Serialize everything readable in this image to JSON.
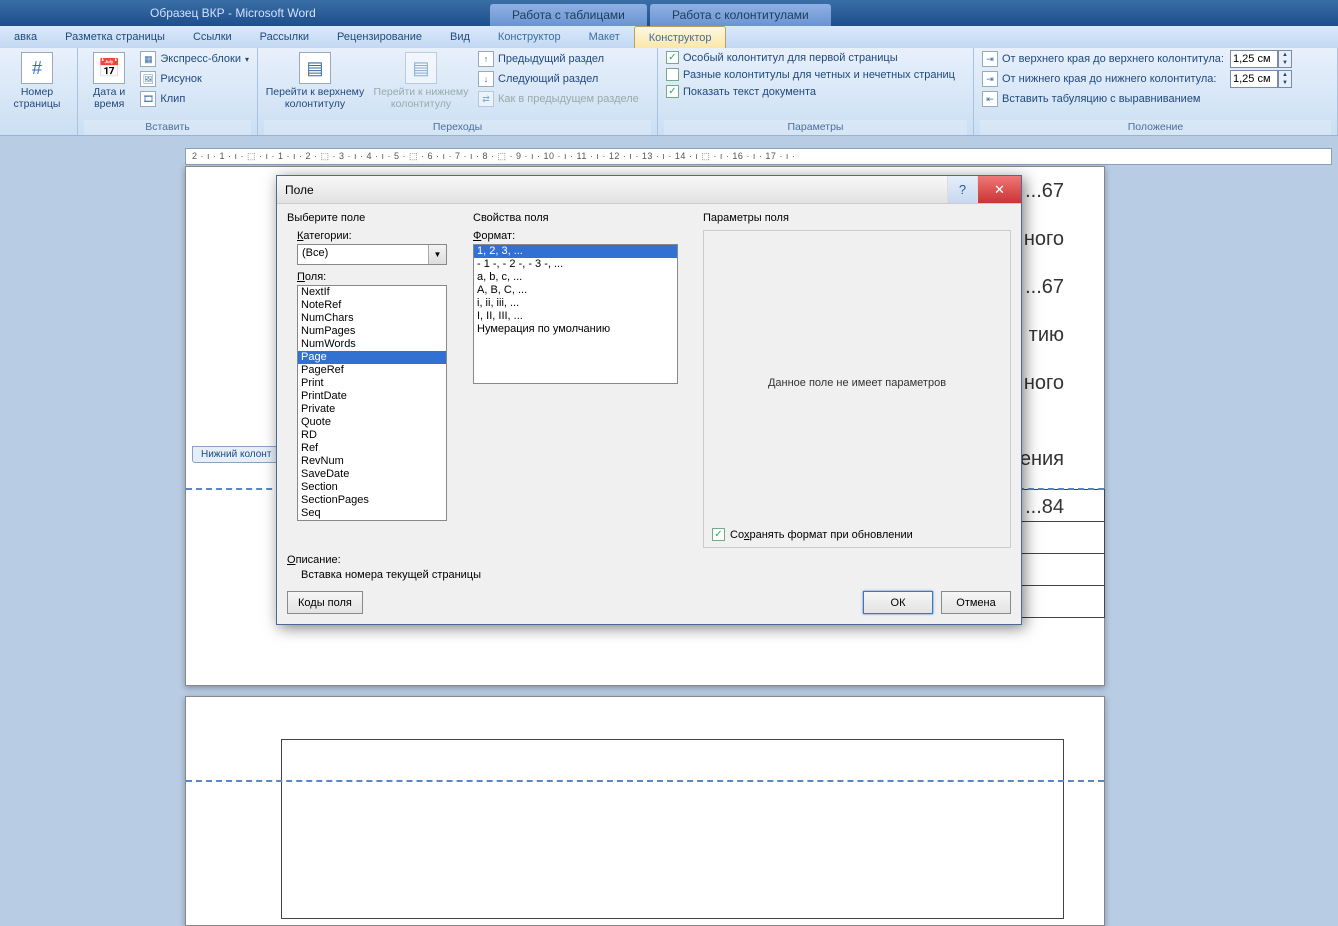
{
  "titlebar": {
    "doc": "Образец ВКР - Microsoft Word",
    "ctx1": "Работа с таблицами",
    "ctx2": "Работа с колонтитулами"
  },
  "tabs": {
    "t0": "авка",
    "t1": "Разметка страницы",
    "t2": "Ссылки",
    "t3": "Рассылки",
    "t4": "Рецензирование",
    "t5": "Вид",
    "t6": "Конструктор",
    "t7": "Макет",
    "t8": "Конструктор"
  },
  "ribbon": {
    "page_number": "Номер страницы",
    "date_time": "Дата и время",
    "express": "Экспресс-блоки",
    "picture": "Рисунок",
    "clip": "Клип",
    "insert_grp": "Вставить",
    "goto_top": "Перейти к верхнему колонтитулу",
    "goto_bottom": "Перейти к нижнему колонтитулу",
    "prev_section": "Предыдущий раздел",
    "next_section": "Следующий раздел",
    "as_prev": "Как в предыдущем разделе",
    "nav_grp": "Переходы",
    "special_first": "Особый колонтитул для первой страницы",
    "odd_even": "Разные колонтитулы для четных и нечетных страниц",
    "show_doc": "Показать текст документа",
    "params_grp": "Параметры",
    "from_top": "От верхнего края до верхнего колонтитула:",
    "from_bottom": "От нижнего края до нижнего колонтитула:",
    "insert_tab": "Вставить табуляцию с выравниванием",
    "pos_grp": "Положение",
    "val_top": "1,25 см",
    "val_bottom": "1,25 см"
  },
  "ruler_text": "2 · ı · 1 · ı · ⬚ · ı · 1 · ı · 2 · ⬚ · 3 · ı · 4 · ı · 5 · ⬚ · 6 · ı · 7 · ı · 8 · ⬚ · 9 · ı · 10 · ı · 11 · ı · 12 · ı · 13 · ı · 14 · ı ⬚ · ı · 16 · ı · 17 · ı · ",
  "footer_tab": "Нижний колонт",
  "doc_text": {
    "l1": "...67",
    "l2": "ного",
    "l3": "...67",
    "l4": "тию",
    "l5": "ного",
    "l6": "ения",
    "l7": "...84"
  },
  "dialog": {
    "title": "Поле",
    "col1_head": "Выберите поле",
    "categories_lbl": "Категории:",
    "categories_accel": "К",
    "category_val": "(Все)",
    "fields_lbl": "Поля:",
    "fields_accel": "П",
    "fields": [
      "NextIf",
      "NoteRef",
      "NumChars",
      "NumPages",
      "NumWords",
      "Page",
      "PageRef",
      "Print",
      "PrintDate",
      "Private",
      "Quote",
      "RD",
      "Ref",
      "RevNum",
      "SaveDate",
      "Section",
      "SectionPages",
      "Seq"
    ],
    "selected_field": "Page",
    "col2_head": "Свойства поля",
    "format_lbl": "Формат:",
    "format_accel": "Ф",
    "formats": [
      "1, 2, 3, ...",
      "- 1 -, - 2 -, - 3 -, ...",
      "a, b, c, ...",
      "A, B, C, ...",
      "i, ii, iii, ...",
      "I, II, III, ...",
      "Нумерация по умолчанию"
    ],
    "selected_format": "1, 2, 3, ...",
    "col3_head": "Параметры поля",
    "no_params": "Данное поле не имеет параметров",
    "preserve": "Сохранять формат при обновлении",
    "preserve_accel": "х",
    "desc_lbl": "Описание:",
    "desc_accel": "О",
    "desc": "Вставка номера текущей страницы",
    "codes_btn": "Коды поля",
    "ok": "ОК",
    "cancel": "Отмена"
  }
}
